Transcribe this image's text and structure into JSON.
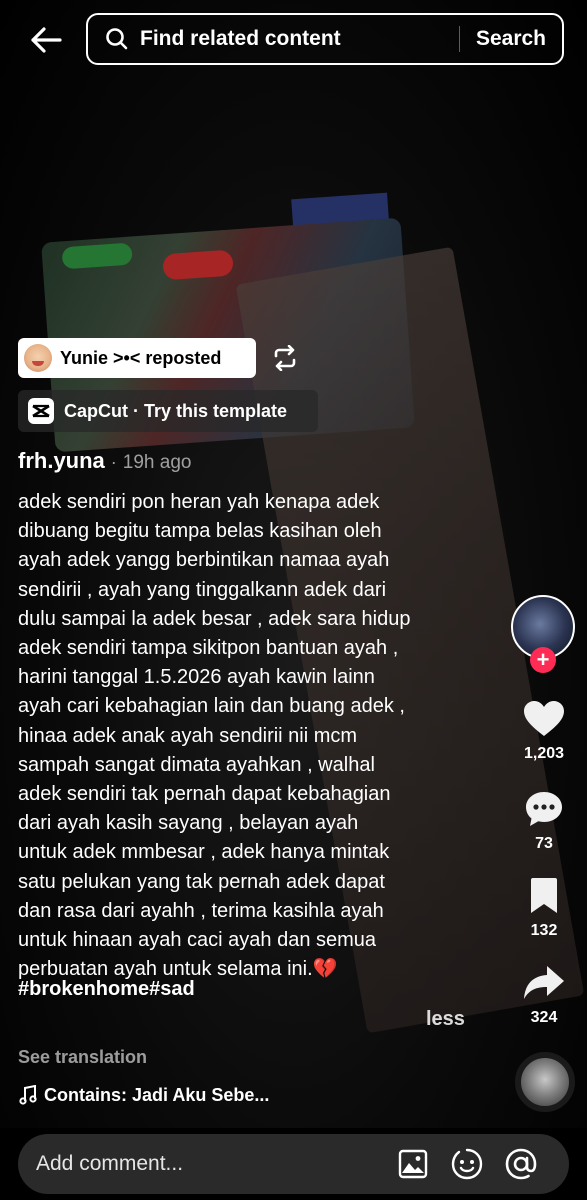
{
  "search": {
    "placeholder": "Find related content",
    "button_label": "Search"
  },
  "repost": {
    "text": "Yunie >•< reposted"
  },
  "capcut": {
    "text": "CapCut · Try this template"
  },
  "post": {
    "author": "frh.yuna",
    "separator": "·",
    "time": "19h ago",
    "caption": "adek sendiri pon heran yah kenapa adek\ndibuang begitu tampa belas kasihan oleh\nayah adek yangg berbintikan namaa ayah\nsendirii , ayah yang tinggalkann adek dari\ndulu sampai la adek besar , adek sara hidup\nadek sendiri tampa sikitpon bantuan ayah ,\nharini tanggal 1.5.2026 ayah kawin lainn\nayah cari kebahagian lain dan buang adek ,\nhinaa adek anak ayah sendirii nii mcm\nsampah sangat dimata ayahkan , walhal\nadek sendiri tak pernah dapat kebahagian\ndari ayah kasih sayang , belayan ayah\nuntuk adek mmbesar , adek hanya mintak\nsatu pelukan yang tak pernah adek dapat\ndan rasa dari ayahh , terima kasihla ayah\nuntuk hinaan ayah caci ayah dan semua\nperbuatan ayah untuk selama ini.💔",
    "hashtags": "#brokenhome#sad",
    "less_label": "less",
    "see_translation": "See translation",
    "music": "Contains: Jadi Aku Sebe..."
  },
  "rail": {
    "follow_plus": "+",
    "likes": "1,203",
    "comments": "73",
    "bookmarks": "132",
    "shares": "324"
  },
  "comment_bar": {
    "placeholder": "Add comment..."
  },
  "colors": {
    "accent": "#fe2c55",
    "background": "#000000",
    "comment_box": "#2a2a2a"
  },
  "icons": [
    "back-arrow-icon",
    "search-icon",
    "repost-icon",
    "capcut-icon",
    "heart-icon",
    "comment-icon",
    "bookmark-icon",
    "share-icon",
    "music-note-icon",
    "image-icon",
    "emoji-icon",
    "mention-icon"
  ]
}
